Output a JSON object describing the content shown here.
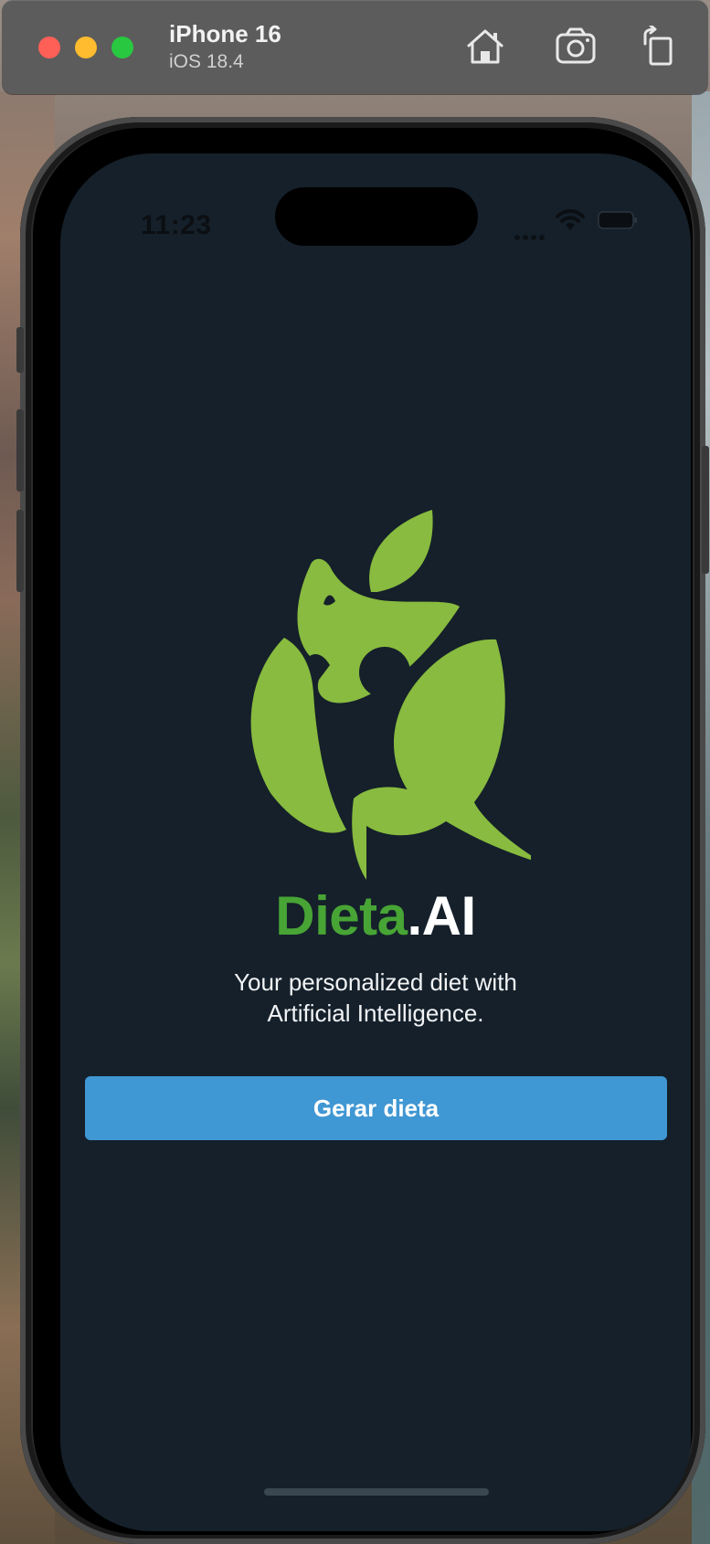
{
  "simulator": {
    "device_name": "iPhone 16",
    "os_version": "iOS 18.4",
    "toolbar_icons": [
      "home-icon",
      "screenshot-icon",
      "rotate-icon"
    ]
  },
  "status_bar": {
    "time": "11:23"
  },
  "app": {
    "brand_primary": "Dieta",
    "brand_secondary": ".AI",
    "tagline_line1": "Your personalized diet with",
    "tagline_line2": "Artificial Intelligence.",
    "cta_label": "Gerar dieta"
  },
  "colors": {
    "screen_background": "#15202a",
    "brand_green": "#47a435",
    "logo_green": "#88bb3f",
    "button_blue": "#3f97d3"
  }
}
